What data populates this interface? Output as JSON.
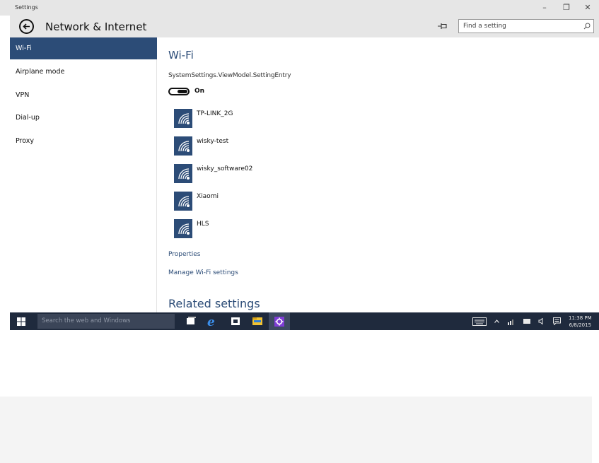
{
  "window": {
    "title": "Settings",
    "minimize_glyph": "–",
    "restore_glyph": "❐",
    "close_glyph": "✕"
  },
  "header": {
    "title": "Network & Internet",
    "search_placeholder": "Find a setting"
  },
  "sidebar": {
    "items": [
      {
        "label": "Wi-Fi",
        "selected": true
      },
      {
        "label": "Airplane mode"
      },
      {
        "label": "VPN"
      },
      {
        "label": "Dial-up"
      },
      {
        "label": "Proxy"
      }
    ]
  },
  "content": {
    "heading": "Wi-Fi",
    "entry_label": "SystemSettings.ViewModel.SettingEntry",
    "toggle_state": "On",
    "networks": [
      {
        "name": "TP-LINK_2G"
      },
      {
        "name": "wisky-test"
      },
      {
        "name": "wisky_software02"
      },
      {
        "name": "Xiaomi"
      },
      {
        "name": "HLS"
      }
    ],
    "links": {
      "properties": "Properties",
      "manage": "Manage Wi-Fi settings"
    },
    "related_heading": "Related settings"
  },
  "taskbar": {
    "search_placeholder": "Search the web and Windows",
    "time": "11:38 PM",
    "date": "6/8/2015"
  },
  "colors": {
    "accent": "#2c4c77",
    "taskbar": "#1f2a3d",
    "chrome": "#e6e6e6"
  },
  "icons": [
    "back-arrow-icon",
    "pin-icon",
    "search-icon",
    "wifi-signal-icon",
    "windows-start-icon",
    "task-view-icon",
    "edge-icon",
    "store-icon",
    "file-explorer-icon",
    "settings-gear-icon",
    "keyboard-icon",
    "chevron-up-icon",
    "network-icon",
    "battery-icon",
    "volume-icon",
    "action-center-icon"
  ]
}
